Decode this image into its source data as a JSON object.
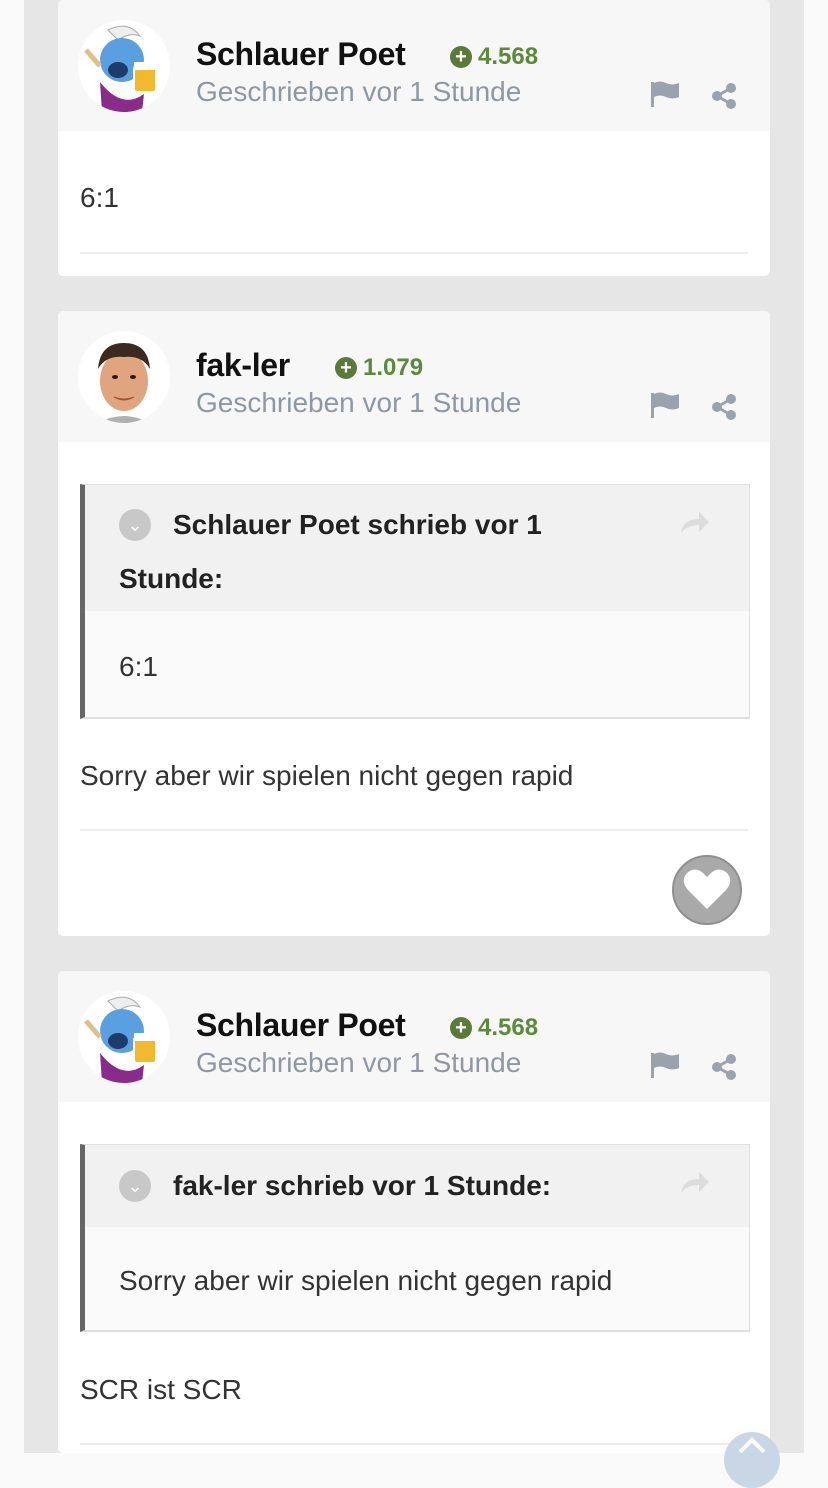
{
  "posts": [
    {
      "author": "Schlauer Poet",
      "reputation": "4.568",
      "meta": "Geschrieben vor 1 Stunde",
      "content": "6:1"
    },
    {
      "author": "fak-ler",
      "reputation": "1.079",
      "meta": "Geschrieben vor 1 Stunde",
      "quote": {
        "title_line1": "Schlauer Poet schrieb vor 1",
        "title_line2": "Stunde:",
        "text": "6:1"
      },
      "content": "Sorry aber wir spielen nicht gegen rapid"
    },
    {
      "author": "Schlauer Poet",
      "reputation": "4.568",
      "meta": "Geschrieben vor 1 Stunde",
      "quote": {
        "title": "fak-ler schrieb vor 1 Stunde:",
        "text": "Sorry aber wir spielen nicht gegen rapid"
      },
      "content": "SCR ist SCR"
    }
  ],
  "colors": {
    "reputation": "#5a8a3a",
    "meta": "#8e98a4",
    "page_bg": "#e6e6e6"
  },
  "icons": {
    "reputation": "plus-circle-icon",
    "report": "flag-icon",
    "share": "share-icon",
    "quote_toggle": "chevron-down-icon",
    "quote_jump": "share-arrow-icon",
    "like": "heart-icon",
    "scroll_top": "chevron-up-icon"
  }
}
